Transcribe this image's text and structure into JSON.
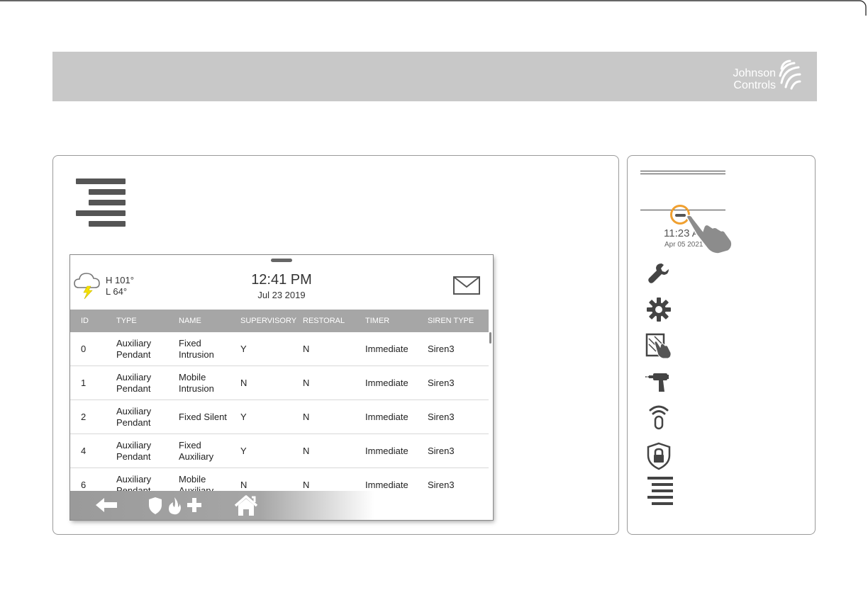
{
  "brand": {
    "line1": "Johnson",
    "line2": "Controls"
  },
  "screen": {
    "weather": {
      "icon": "storm-cloud-icon",
      "high": "H 101°",
      "low": "L 64°"
    },
    "time": "12:41 PM",
    "date": "Jul 23 2019",
    "table": {
      "headers": [
        "ID",
        "TYPE",
        "NAME",
        "SUPERVISORY",
        "RESTORAL",
        "TIMER",
        "SIREN TYPE"
      ],
      "rows": [
        {
          "id": "0",
          "type": [
            "Auxiliary",
            "Pendant"
          ],
          "name": [
            "Fixed",
            "Intrusion"
          ],
          "supervisory": "Y",
          "restoral": "N",
          "timer": "Immediate",
          "siren": "Siren3"
        },
        {
          "id": "1",
          "type": [
            "Auxiliary",
            "Pendant"
          ],
          "name": [
            "Mobile",
            "Intrusion"
          ],
          "supervisory": "N",
          "restoral": "N",
          "timer": "Immediate",
          "siren": "Siren3"
        },
        {
          "id": "2",
          "type": [
            "Auxiliary",
            "Pendant"
          ],
          "name": [
            "Fixed Silent",
            ""
          ],
          "supervisory": "Y",
          "restoral": "N",
          "timer": "Immediate",
          "siren": "Siren3"
        },
        {
          "id": "4",
          "type": [
            "Auxiliary",
            "Pendant"
          ],
          "name": [
            "Fixed",
            "Auxiliary"
          ],
          "supervisory": "Y",
          "restoral": "N",
          "timer": "Immediate",
          "siren": "Siren3"
        },
        {
          "id": "6",
          "type": [
            "Auxiliary",
            "Pendant"
          ],
          "name": [
            "Mobile",
            "Auxiliary"
          ],
          "supervisory": "N",
          "restoral": "N",
          "timer": "Immediate",
          "siren": "Siren3"
        }
      ]
    },
    "footer_icons": [
      "back-arrow-icon",
      "shield-icon",
      "fire-icon",
      "medical-cross-icon",
      "home-icon"
    ]
  },
  "side": {
    "time": "11:23 AM",
    "date": "Apr 05 2021",
    "icons": [
      "wrench-icon",
      "gear-icon",
      "panel-touch-icon",
      "drill-icon",
      "wireless-device-icon",
      "lock-shield-icon",
      "menu-icon"
    ]
  },
  "colors": {
    "header_band": "#c8c8c8",
    "table_header": "#a6a6a6",
    "hint_ring": "#f0a030",
    "lightning": "#f5e000"
  }
}
